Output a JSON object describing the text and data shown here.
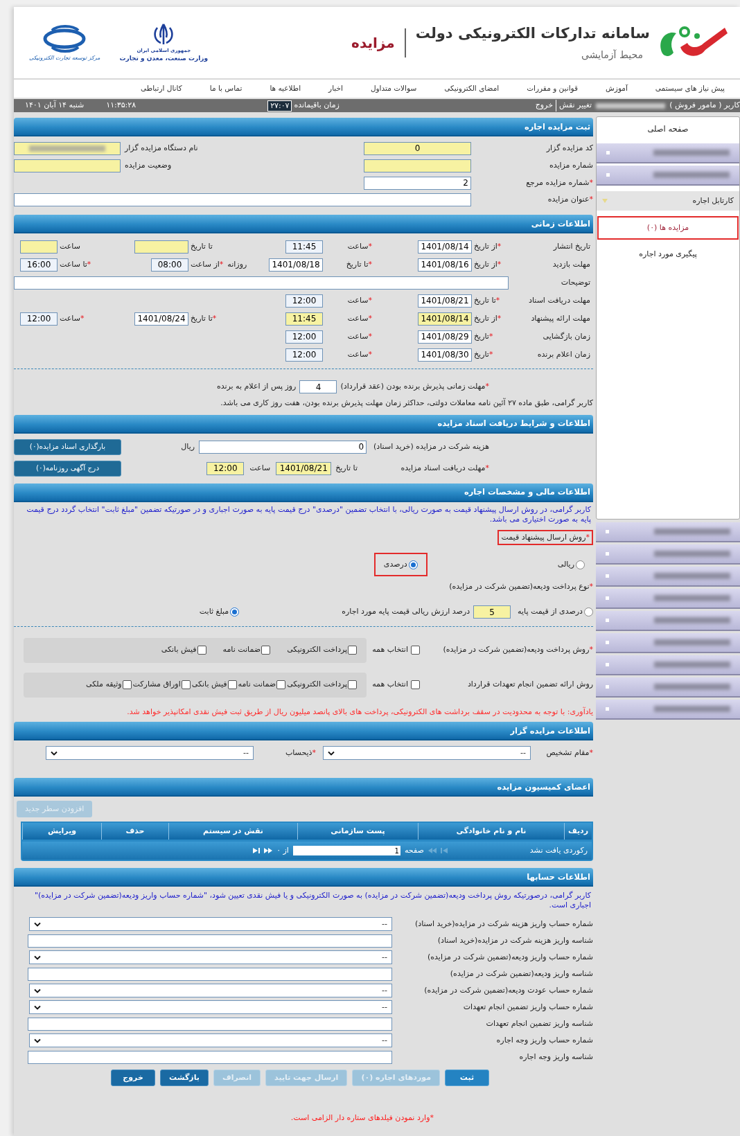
{
  "required_mark": "*",
  "header": {
    "title": "سامانه تدارکات الکترونیکی دولت",
    "subtitle": "محیط آزمایشی",
    "module": "مزایده",
    "ministry_lines": [
      "جمهوری اسلامی ایران",
      "وزارت صنعت، معدن و تجارت"
    ],
    "center_caption": "مرکز توسعه تجارت الکترونیکی"
  },
  "nav": [
    "پیش نیاز های سیستمی",
    "آموزش",
    "قوانین و مقررات",
    "امضای الکترونیکی",
    "سوالات متداول",
    "اخبار",
    "اطلاعیه ها",
    "تماس با ما",
    "کانال ارتباطی"
  ],
  "status_bar": {
    "user": "کاربر ( مامور فروش )",
    "change_role": "تغییر نقش",
    "logout": "خروج",
    "remaining_label": "زمان باقیمانده",
    "remaining": "۲۷:۰۷",
    "time": "۱۱:۳۵:۲۸",
    "date": "شنبه ۱۴ آبان ۱۴۰۱"
  },
  "sidebar": {
    "items": [
      {
        "kind": "link",
        "label": "صفحه اصلی"
      },
      {
        "kind": "redacted"
      },
      {
        "kind": "redacted"
      },
      {
        "kind": "group",
        "label": "کارتابل اجاره",
        "expanded": true,
        "children": [
          {
            "label": "مزایده ها (۰)",
            "selected": true
          },
          {
            "label": "پیگیری مورد اجاره",
            "selected": false
          }
        ]
      }
    ],
    "more": [
      {
        "kind": "redacted"
      },
      {
        "kind": "redacted"
      },
      {
        "kind": "redacted"
      },
      {
        "kind": "redacted"
      },
      {
        "kind": "redacted"
      },
      {
        "kind": "redacted"
      },
      {
        "kind": "redacted"
      },
      {
        "kind": "redacted"
      },
      {
        "kind": "redacted"
      }
    ]
  },
  "register": {
    "title": "ثبت مزایده اجاره",
    "rows": [
      [
        {
          "label": "کد مزایده گزار",
          "value": "0",
          "highlighted": true,
          "required": false
        },
        {
          "label": "نام دستگاه مزایده گزار",
          "redacted": true,
          "highlighted": true,
          "required": false
        }
      ],
      [
        {
          "label": "شماره مزایده",
          "highlighted": true,
          "required": false
        },
        {
          "label": "وضعیت مزایده",
          "highlighted": true,
          "required": false
        }
      ],
      [
        {
          "label": "شماره مزایده مرجع",
          "value": "2",
          "highlighted": false,
          "required": true
        }
      ]
    ],
    "title_field": {
      "label": "عنوان مزایده",
      "required": true
    }
  },
  "timing": {
    "title": "اطلاعات زمانی",
    "rows": [
      {
        "label": "تاریخ انتشار",
        "cells": [
          {
            "caption": "از تاریخ",
            "required": true,
            "kind": "date",
            "value": "1401/08/14",
            "highlighted": false
          },
          {
            "caption": "ساعت",
            "required": true,
            "kind": "time",
            "value": "11:45",
            "highlighted": false
          },
          {
            "caption": "تا تاریخ",
            "required": false,
            "kind": "date",
            "highlighted": true
          },
          {
            "caption": "ساعت",
            "required": false,
            "kind": "time",
            "highlighted": true
          }
        ]
      },
      {
        "label": "مهلت بازدید",
        "cells": [
          {
            "caption": "از تاریخ",
            "required": true,
            "kind": "date",
            "value": "1401/08/16",
            "highlighted": false
          },
          {
            "caption": "تا تاریخ",
            "required": true,
            "kind": "date",
            "value": "1401/08/18",
            "highlighted": false
          },
          {
            "prefix": "روزانه",
            "caption": "از ساعت",
            "required": true,
            "kind": "time",
            "value": "08:00",
            "highlighted": false
          },
          {
            "caption": "تا ساعت",
            "required": true,
            "kind": "time",
            "value": "16:00",
            "highlighted": false
          }
        ]
      },
      {
        "label": "توضیحات",
        "kind": "wide"
      },
      {
        "label": "مهلت دریافت اسناد",
        "cells": [
          {
            "caption": "تا تاریخ",
            "required": true,
            "kind": "date",
            "value": "1401/08/21",
            "highlighted": false
          },
          {
            "caption": "ساعت",
            "required": true,
            "kind": "time",
            "value": "12:00",
            "highlighted": false
          }
        ]
      },
      {
        "label": "مهلت ارائه پیشنهاد",
        "cells": [
          {
            "caption": "از تاریخ",
            "required": true,
            "kind": "date",
            "value": "1401/08/14",
            "highlighted": true
          },
          {
            "caption": "ساعت",
            "required": true,
            "kind": "time",
            "value": "11:45",
            "highlighted": true
          },
          {
            "caption": "تا تاریخ",
            "required": true,
            "kind": "date",
            "value": "1401/08/24",
            "highlighted": false
          },
          {
            "caption": "ساعت",
            "required": true,
            "kind": "time",
            "value": "12:00",
            "highlighted": false
          }
        ]
      },
      {
        "label": "زمان بازگشایی",
        "cells": [
          {
            "caption": "تاریخ",
            "required": true,
            "kind": "date",
            "value": "1401/08/29",
            "highlighted": false
          },
          {
            "caption": "ساعت",
            "required": true,
            "kind": "time",
            "value": "12:00",
            "highlighted": false
          }
        ]
      },
      {
        "label": "زمان اعلام برنده",
        "cells": [
          {
            "caption": "تاریخ",
            "required": true,
            "kind": "date",
            "value": "1401/08/30",
            "highlighted": false
          },
          {
            "caption": "ساعت",
            "required": true,
            "kind": "time",
            "value": "12:00",
            "highlighted": false
          }
        ]
      }
    ],
    "acceptance": {
      "label": "مهلت زمانی پذیرش برنده بودن (عقد قرارداد)",
      "required": true,
      "value": "4",
      "suffix": "روز پس از اعلام به برنده"
    },
    "note": "کاربر گرامی، طبق ماده ۲۷ آئین نامه معاملات دولتی، حداکثر زمان مهلت پذیرش برنده بودن، هفت روز کاری می باشد."
  },
  "documents": {
    "title": "اطلاعات و شرایط دریافت اسناد مزایده",
    "fee_label": "هزینه شرکت در مزایده (خرید اسناد)",
    "fee_value": "0",
    "fee_unit": "ریال",
    "deadline_label": "مهلت دریافت اسناد مزایده",
    "deadline_required": true,
    "date_caption": "تا تاریخ",
    "date": {
      "value": "1401/08/21",
      "highlighted": true
    },
    "time_caption": "ساعت",
    "time": {
      "value": "12:00",
      "highlighted": true
    },
    "buttons": [
      "بارگذاری اسناد مزایده(۰)",
      "درج آگهی روزنامه(۰)"
    ]
  },
  "finance": {
    "title": "اطلاعات مالی و مشخصات اجاره",
    "note": "کاربر گرامی، در روش ارسال پیشنهاد قیمت به صورت ریالی، با انتخاب تضمین \"درصدی\" درج قیمت پایه به صورت اجباری و در صورتیکه تضمین \"مبلغ ثابت\" انتخاب گردد درج قیمت پایه به صورت اختیاری می باشد.",
    "price_method": {
      "label": "روش ارسال پیشنهاد قیمت",
      "required": true,
      "outlined": true,
      "options": [
        {
          "label": "ریالی",
          "selected": false,
          "outlined": false
        },
        {
          "label": "درصدی",
          "selected": true,
          "outlined": true
        }
      ]
    },
    "deposit_type": {
      "label": "نوع پرداخت ودیعه(تضمین شرکت در مزایده)",
      "required": true,
      "percent_option": {
        "label": "درصدی از قیمت پایه",
        "selected": false
      },
      "percent_value": "5",
      "percent_suffix": "درصد ارزش ریالی قیمت پایه مورد اجاره",
      "fixed_option": {
        "label": "مبلغ ثابت",
        "selected": true
      }
    },
    "deposit_methods": {
      "label": "روش پرداخت ودیعه(تضمین شرکت در مزایده)",
      "required": true,
      "select_all": {
        "label": "انتخاب همه",
        "checked": false
      },
      "options": [
        {
          "label": "پرداخت الکترونیکی",
          "checked": false
        },
        {
          "label": "ضمانت نامه",
          "checked": false
        },
        {
          "label": "فیش بانکی",
          "checked": false
        }
      ]
    },
    "guarantee_methods": {
      "label": "روش ارائه تضمین انجام تعهدات قرارداد",
      "required": false,
      "select_all": {
        "label": "انتخاب همه",
        "checked": false
      },
      "options": [
        {
          "label": "پرداخت الکترونیکی",
          "checked": false
        },
        {
          "label": "ضمانت نامه",
          "checked": false
        },
        {
          "label": "فیش بانکی",
          "checked": false
        },
        {
          "label": "اوراق مشارکت",
          "checked": false
        },
        {
          "label": "وثیقه ملکی",
          "checked": false
        }
      ]
    },
    "reminder": "یادآوری: با توجه به محدودیت در سقف برداشت های الکترونیکی، پرداخت های بالای پانصد میلیون ریال از طریق ثبت فیش نقدی امکانپذیر خواهد شد."
  },
  "auctioneer": {
    "title": "اطلاعات مزایده گزار",
    "fields": [
      {
        "label": "مقام تشخیص",
        "required": true,
        "value": "--"
      },
      {
        "label": "ذیحساب",
        "required": true,
        "value": "--"
      }
    ]
  },
  "commission": {
    "title": "اعضای کمیسیون مزایده",
    "add_button": {
      "label": "افزودن سطر جدید",
      "disabled": true
    },
    "columns": [
      "ردیف",
      "نام و نام خانوادگی",
      "پست سازمانی",
      "نقش در سیستم",
      "حذف",
      "ویرایش"
    ],
    "pager": {
      "empty": "رکوردی یافت نشد",
      "page_label": "صفحه",
      "page": "1",
      "of": "از ۰"
    }
  },
  "accounts": {
    "title": "اطلاعات حسابها",
    "note": "کاربر گرامی، درصورتیکه روش پرداخت ودیعه(تضمین شرکت در مزایده) به صورت الکترونیکی و یا فیش نقدی تعیین شود، \"شماره حساب واریز ودیعه(تضمین شرکت در مزایده)\" اجباری است.",
    "rows": [
      {
        "label": "شماره حساب واریز هزینه شرکت در مزایده(خرید اسناد)",
        "kind": "select",
        "value": "--"
      },
      {
        "label": "شناسه واریز هزینه شرکت در مزایده(خرید اسناد)",
        "kind": "input"
      },
      {
        "label": "شماره حساب واریز ودیعه(تضمین شرکت در مزایده)",
        "kind": "select",
        "value": "--"
      },
      {
        "label": "شناسه واریز ودیعه(تضمین شرکت در مزایده)",
        "kind": "input"
      },
      {
        "label": "شماره حساب عودت ودیعه(تضمین شرکت در مزایده)",
        "kind": "select",
        "value": "--"
      },
      {
        "label": "شماره حساب واریز تضمین انجام تعهدات",
        "kind": "select",
        "value": "--"
      },
      {
        "label": "شناسه واریز تضمین انجام تعهدات",
        "kind": "input"
      },
      {
        "label": "شماره حساب واریز وجه اجاره",
        "kind": "select",
        "value": "--"
      },
      {
        "label": "شناسه واریز وجه اجاره",
        "kind": "input"
      }
    ]
  },
  "actions": [
    {
      "label": "ثبت",
      "disabled": false
    },
    {
      "label": "موردهای اجاره (۰)",
      "disabled": true
    },
    {
      "label": "ارسال جهت تایید",
      "disabled": true
    },
    {
      "label": "انصراف",
      "disabled": true
    },
    {
      "label": "بازگشت",
      "disabled": false
    },
    {
      "label": "خروج",
      "disabled": false
    }
  ],
  "footer_note": "*وارد نمودن فیلدهای ستاره دار الزامی است."
}
